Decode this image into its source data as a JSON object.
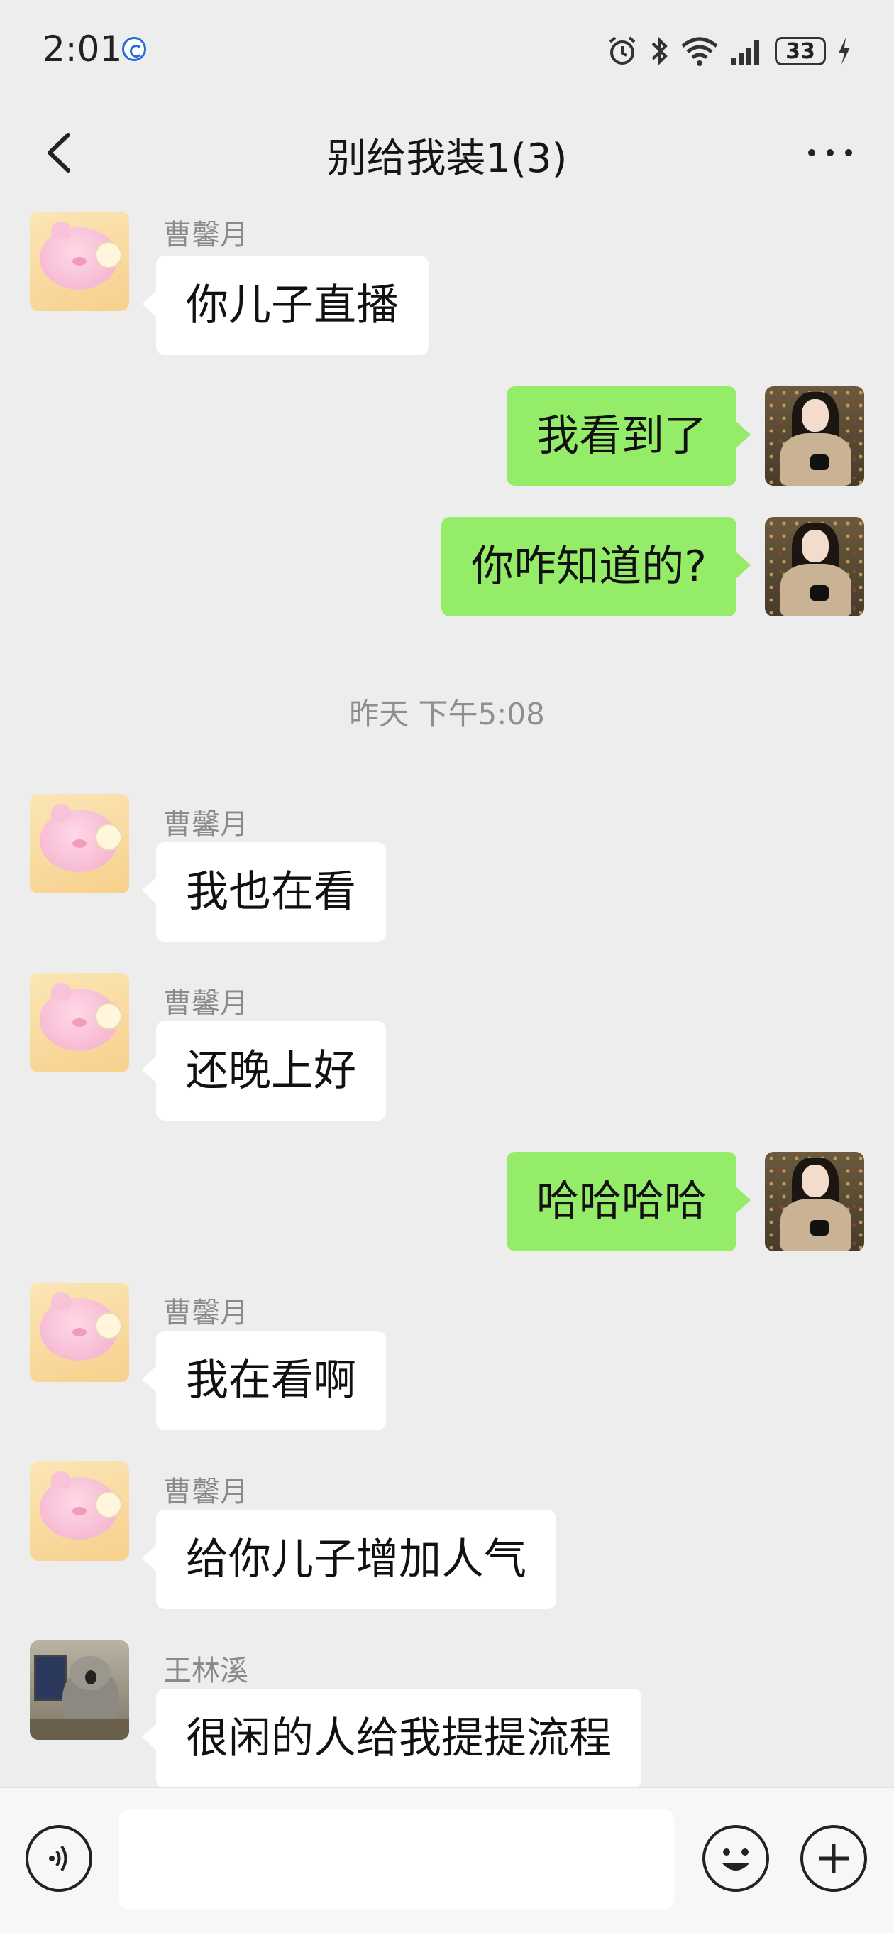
{
  "status_bar": {
    "time": "2:01",
    "battery": "33"
  },
  "header": {
    "title": "别给我装1(3)"
  },
  "messages": [
    {
      "side": "in",
      "sender": "曹馨月",
      "text": "你儿子直播"
    },
    {
      "side": "out",
      "text": "我看到了"
    },
    {
      "side": "out",
      "text": "你咋知道的?"
    },
    {
      "side": "in",
      "sender": "曹馨月",
      "text": "我也在看"
    },
    {
      "side": "in",
      "sender": "曹馨月",
      "text": "还晚上好"
    },
    {
      "side": "out",
      "text": "哈哈哈哈"
    },
    {
      "side": "in",
      "sender": "曹馨月",
      "text": "我在看啊"
    },
    {
      "side": "in",
      "sender": "曹馨月",
      "text": "给你儿子增加人气"
    },
    {
      "side": "in",
      "sender": "王林溪",
      "text": "很闲的人给我提提流程"
    }
  ],
  "timestamp": "昨天 下午5:08",
  "input_bar": {
    "value": ""
  },
  "colors": {
    "outgoing_bubble": "#95ec69",
    "incoming_bubble": "#ffffff",
    "background": "#ededed"
  },
  "icons": [
    "back-arrow-icon",
    "more-icon",
    "voice-icon",
    "emoji-icon",
    "plus-icon",
    "alarm-icon",
    "bluetooth-icon",
    "wifi-icon",
    "signal-icon",
    "battery-icon",
    "charging-icon"
  ]
}
